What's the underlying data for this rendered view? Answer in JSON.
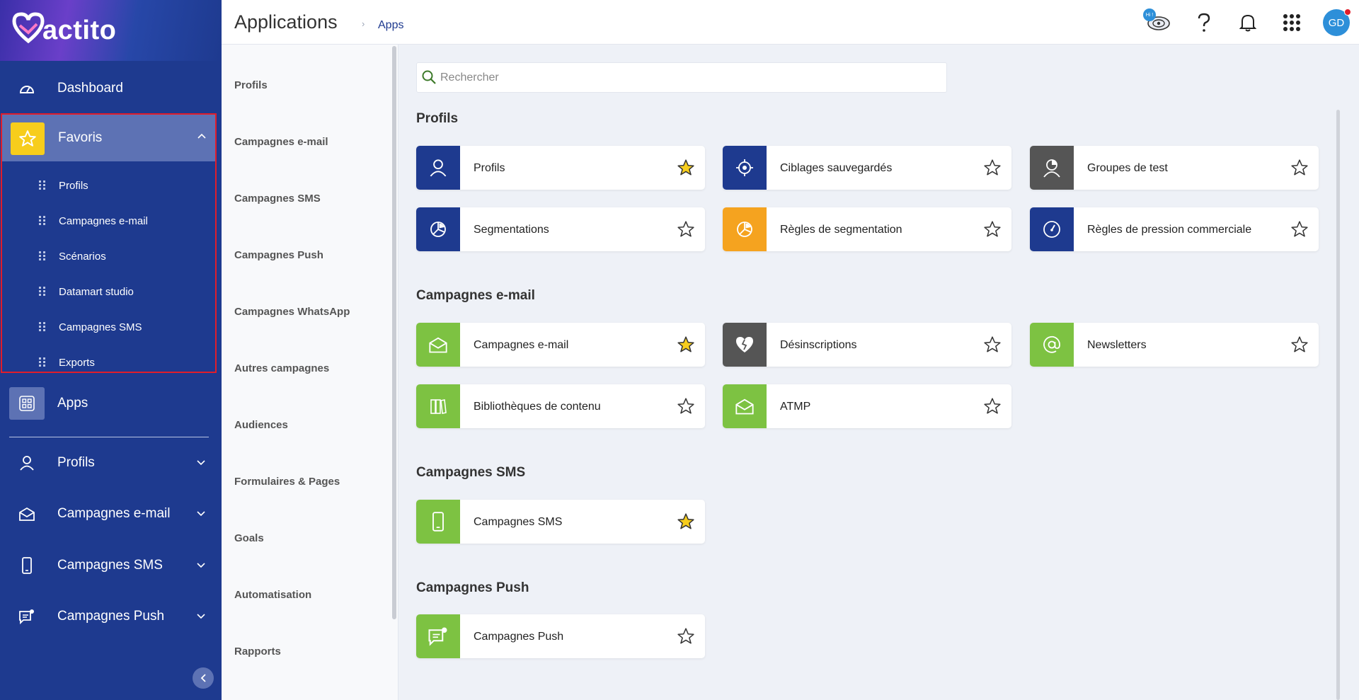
{
  "brand": {
    "logo_text": "actito",
    "accent": "#1e3a8f",
    "favoris_highlight": "#e11d2a"
  },
  "sidebar": {
    "dashboard_label": "Dashboard",
    "favoris": {
      "label": "Favoris",
      "items": [
        "Profils",
        "Campagnes e-mail",
        "Scénarios",
        "Datamart studio",
        "Campagnes SMS",
        "Exports"
      ]
    },
    "apps_label": "Apps",
    "sections": [
      "Profils",
      "Campagnes e-mail",
      "Campagnes SMS",
      "Campagnes Push"
    ]
  },
  "header": {
    "title": "Applications",
    "breadcrumb": "Apps",
    "hi_badge": "Hi !",
    "avatar_initials": "GD"
  },
  "categories": [
    "Profils",
    "Campagnes e-mail",
    "Campagnes SMS",
    "Campagnes Push",
    "Campagnes WhatsApp",
    "Autres campagnes",
    "Audiences",
    "Formulaires & Pages",
    "Goals",
    "Automatisation",
    "Rapports"
  ],
  "search": {
    "placeholder": "Rechercher",
    "value": ""
  },
  "sections": [
    {
      "title": "Profils",
      "apps": [
        {
          "label": "Profils",
          "icon": "person-icon",
          "color": "#1e3a8f",
          "favorite": true
        },
        {
          "label": "Ciblages sauvegardés",
          "icon": "target-icon",
          "color": "#1e3a8f",
          "favorite": false
        },
        {
          "label": "Groupes de test",
          "icon": "test-group-icon",
          "color": "#555555",
          "favorite": false
        },
        {
          "label": "Segmentations",
          "icon": "pie-icon",
          "color": "#1e3a8f",
          "favorite": false
        },
        {
          "label": "Règles de segmentation",
          "icon": "pie-icon",
          "color": "#f5a31f",
          "favorite": false
        },
        {
          "label": "Règles de pression commerciale",
          "icon": "gauge-icon",
          "color": "#1e3a8f",
          "favorite": false
        }
      ]
    },
    {
      "title": "Campagnes e-mail",
      "apps": [
        {
          "label": "Campagnes e-mail",
          "icon": "envelope-icon",
          "color": "#7dc242",
          "favorite": true
        },
        {
          "label": "Désinscriptions",
          "icon": "broken-heart-icon",
          "color": "#555555",
          "favorite": false
        },
        {
          "label": "Newsletters",
          "icon": "at-icon",
          "color": "#7dc242",
          "favorite": false
        },
        {
          "label": "Bibliothèques de contenu",
          "icon": "library-icon",
          "color": "#7dc242",
          "favorite": false
        },
        {
          "label": "ATMP",
          "icon": "envelope-icon",
          "color": "#7dc242",
          "favorite": false
        }
      ]
    },
    {
      "title": "Campagnes SMS",
      "apps": [
        {
          "label": "Campagnes SMS",
          "icon": "phone-icon",
          "color": "#7dc242",
          "favorite": true
        }
      ]
    },
    {
      "title": "Campagnes Push",
      "apps": [
        {
          "label": "Campagnes Push",
          "icon": "push-message-icon",
          "color": "#7dc242",
          "favorite": false
        }
      ]
    }
  ]
}
